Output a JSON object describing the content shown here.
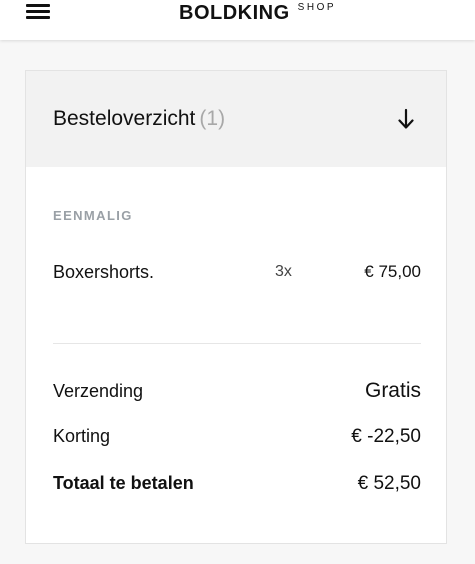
{
  "header": {
    "logo_main": "BOLDKING",
    "logo_sub": "SHOP"
  },
  "order_summary": {
    "title": "Besteloverzicht",
    "count": "(1)",
    "section_label": "EENMALIG",
    "items": [
      {
        "name": "Boxershorts.",
        "quantity": "3x",
        "price": "€ 75,00"
      }
    ],
    "shipping_label": "Verzending",
    "shipping_value": "Gratis",
    "discount_label": "Korting",
    "discount_value": "€ -22,50",
    "total_label": "Totaal te betalen",
    "total_value": "€ 52,50"
  }
}
